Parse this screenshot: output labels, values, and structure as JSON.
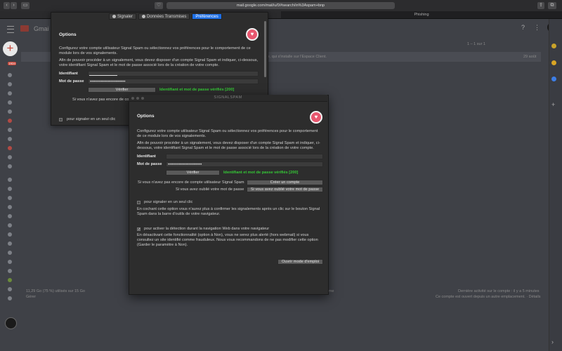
{
  "browser": {
    "url": "mail.google.com/mail/u/0/#search/in%3Aspam+bnp",
    "tab_title": "Phishing"
  },
  "gmail": {
    "logo_text": "Gmai",
    "badge_count": "1934",
    "pager_text": "1 – 1 sur 1",
    "row_snippet": "d'authentification forte, qui s'installe sur l'Espace Client.",
    "row_time": "29 août",
    "storage_text": "11,29 Go (75 %) utilisés sur 15 Go",
    "manage_text": "Gérer",
    "mid_footer_text": "rme",
    "activity_text": "Dernière activité sur le compte : il y a 5 minutes",
    "open_text": "Ce compte est ouvert depuis un autre emplacement. · Détails"
  },
  "prefs_back": {
    "tabs": [
      "Signaler",
      "Données Transmises",
      "Préférences"
    ],
    "title": "Options",
    "intro": "Configurez votre compte utilisateur Signal Spam ou sélectionnez vos préférences pour le comportement de ce module lors de vos signalements.",
    "instructions": "Afin de pouvoir procéder à un signalement, vous devez disposer d'un compte Signal Spam et indiquer, ci-dessous, votre identifiant Signal Spam et le mot de passe associé lors de la création de votre compte.",
    "identifiant_label": "Identifiant",
    "password_label": "Mot de passe",
    "password_value": "••••••••••••••••••••••••",
    "verify_button": "Vérifier",
    "verified_text": "Identifiant et mot de passe vérifiés [200]",
    "no_account_partial": "Si vous n'avez pas encore de co",
    "one_click_label": "pour signaler en un seul clic"
  },
  "prefs_front": {
    "window_title": "SIGNALSPAM",
    "title": "Options",
    "intro": "Configurez votre compte utilisateur Signal Spam ou sélectionnez vos préférences pour le comportement de ce module lors de vos signalements.",
    "instructions": "Afin de pouvoir procéder à un signalement, vous devez disposer d'un compte Signal Spam et indiquer, ci-dessous, votre identifiant Signal Spam et le mot de passe associé lors de la création de votre compte.",
    "identifiant_label": "Identifiant",
    "password_label": "Mot de passe",
    "password_value": "•••••••••••••••••••••••",
    "verify_button": "Vérifier",
    "verified_text": "Identifiant et mot de passe vérifiés [200]",
    "no_account_text": "Si vous n'avez pas encore de compte utilisateur Signal Spam",
    "create_account_button": "Créer un compte",
    "forgot_password_text": "Si vous avez oublié votre mot de passe",
    "forgot_password_button": "Si vous avez oublié votre mot de passe",
    "one_click_label": "pour signaler en un seul clic",
    "one_click_desc": "En cochant cette option vous n'aurez plus à confirmer les signalements après un clic sur le bouton Signal Spam dans la barre d'outils de votre navigateur.",
    "detection_label": "pour activer la détection durant la navigation Web dans votre navigateur",
    "detection_desc": "En désactivant cette fonctionnalité (option à Non), vous ne serez plus alerté (hors webmail) si vous consultez un site identifié comme frauduleux. Nous vous recommandons de ne pas modifier cette option (Garder le paramètre à Non).",
    "manual_button": "Ouvrir mode d'emploi"
  },
  "colors": {
    "accent_blue": "#1d6ee5",
    "success_green": "#35c936",
    "logo_pink": "#e8576f",
    "gmail_red": "#c94437"
  }
}
